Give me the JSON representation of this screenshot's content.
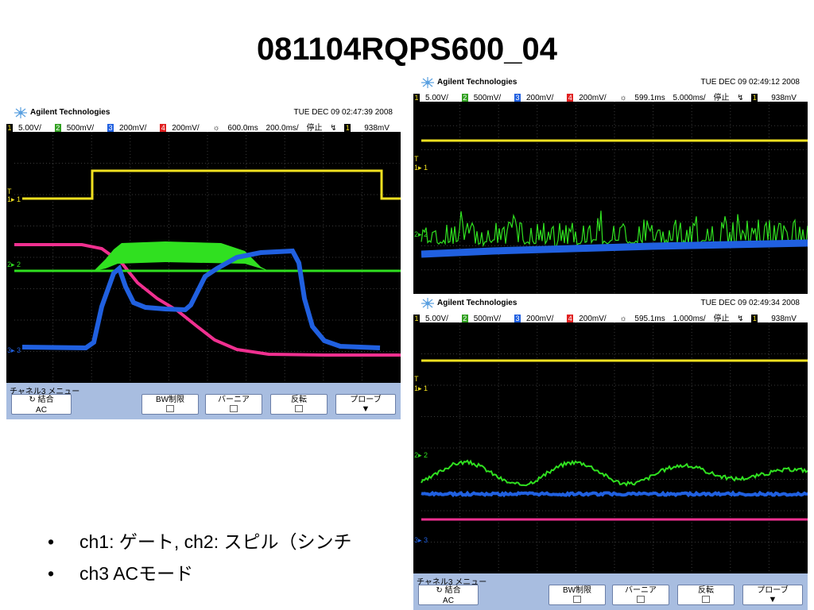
{
  "slide": {
    "title": "081104RQPS600_04",
    "bullets": [
      "ch1: ゲート, ch2: スピル（シンチ",
      "ch3 ACモード"
    ],
    "bullet_char": "•"
  },
  "scopes": [
    {
      "brand": "Agilent Technologies",
      "date": "TUE DEC 09 02:47:39 2008",
      "ch1": "5.00V/",
      "ch2": "500mV/",
      "ch3": "200mV/",
      "ch4": "200mV/",
      "time_pos": "600.0ms",
      "time_div": "200.0ms/",
      "run_state": "停止",
      "trig_ch": "1",
      "trig_level": "938mV",
      "menu_title": "チャネル3 メニュー",
      "keys": {
        "coupling": "結合",
        "coupling_val": "AC",
        "bw": "BW制限",
        "vernier": "バーニア",
        "invert": "反転",
        "probe": "プローブ"
      }
    },
    {
      "brand": "Agilent Technologies",
      "date": "TUE DEC 09 02:49:12 2008",
      "ch1": "5.00V/",
      "ch2": "500mV/",
      "ch3": "200mV/",
      "ch4": "200mV/",
      "time_pos": "599.1ms",
      "time_div": "5.000ms/",
      "run_state": "停止",
      "trig_ch": "1",
      "trig_level": "938mV"
    },
    {
      "brand": "Agilent Technologies",
      "date": "TUE DEC 09 02:49:34 2008",
      "ch1": "5.00V/",
      "ch2": "500mV/",
      "ch3": "200mV/",
      "ch4": "200mV/",
      "time_pos": "595.1ms",
      "time_div": "1.000ms/",
      "run_state": "停止",
      "trig_ch": "1",
      "trig_level": "938mV",
      "menu_title": "チャネル3 メニュー",
      "keys": {
        "coupling": "結合",
        "coupling_val": "AC",
        "bw": "BW制限",
        "vernier": "バーニア",
        "invert": "反転",
        "probe": "プローブ"
      }
    }
  ],
  "colors": {
    "ch1": "#f0e020",
    "ch2": "#30e020",
    "ch3": "#2060e0",
    "ch4": "#f03090",
    "screen_bg": "#000000",
    "grid": "#3a3a3a",
    "menu_bg": "#a8bde0"
  }
}
